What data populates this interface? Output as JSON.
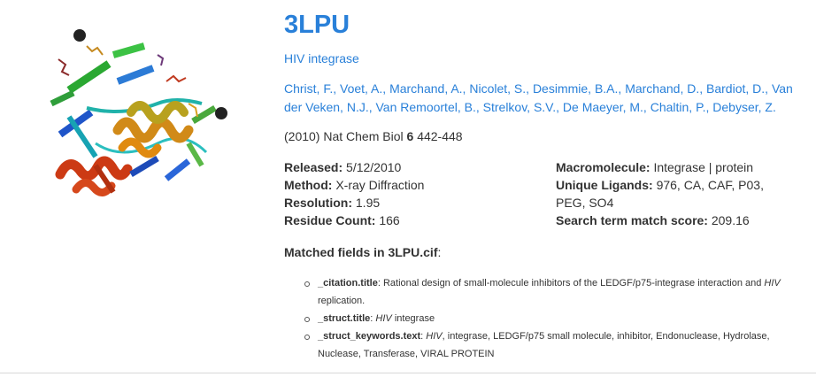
{
  "entry": {
    "id": "3LPU",
    "title": "HIV integrase",
    "authors": [
      "Christ, F.,",
      "Voet, A.,",
      "Marchand, A.,",
      "Nicolet, S.,",
      "Desimmie, B.A.,",
      "Marchand, D.,",
      "Bardiot, D.,",
      "Van der Veken, N.J.,",
      "Van Remoortel, B.,",
      "Strelkov, S.V.,",
      "De Maeyer, M.,",
      "Chaltin, P.,",
      "Debyser, Z."
    ],
    "citation": {
      "year_journal": "(2010) Nat Chem Biol",
      "volume": "6",
      "pages": "442-448"
    },
    "released_label": "Released:",
    "released_value": "5/12/2010",
    "method_label": "Method:",
    "method_value": "X-ray Diffraction",
    "resolution_label": "Resolution:",
    "resolution_value": "1.95",
    "residue_label": "Residue Count:",
    "residue_value": "166",
    "macromolecule_label": "Macromolecule:",
    "macromolecule_value": "Integrase | protein",
    "ligands_label": "Unique Ligands:",
    "ligands_value": "976, CA, CAF, P03, PEG, SO4",
    "score_label": "Search term match score:",
    "score_value": "209.16"
  },
  "matched": {
    "heading_prefix": "Matched fields in",
    "filename": "3LPU.cif",
    "heading_suffix": ":",
    "fields": [
      {
        "name": "_citation.title",
        "sep": ": ",
        "text_a": "Rational design of small-molecule inhibitors of the LEDGF/p75-integrase interaction and ",
        "em": "HIV",
        "text_b": " replication."
      },
      {
        "name": "_struct.title",
        "sep": ": ",
        "text_a": "",
        "em": "HIV",
        "text_b": " integrase"
      },
      {
        "name": "_struct_keywords.text",
        "sep": ": ",
        "text_a": "",
        "em": "HIV",
        "text_b": ", integrase, LEDGF/p75 small molecule, inhibitor, Endonuclease, Hydrolase, Nuclease, Transferase, VIRAL PROTEIN"
      }
    ]
  },
  "colors": {
    "link": "#2980d9",
    "text": "#333333"
  },
  "icons": {
    "structure_thumbnail": "protein-cartoon-image",
    "bullet": "open-circle-bullet"
  }
}
